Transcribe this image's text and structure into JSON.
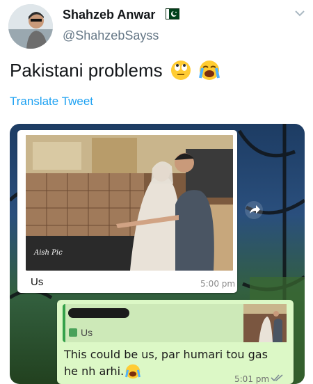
{
  "author": {
    "name": "Shahzeb Anwar",
    "handle": "@ShahzebSayss",
    "flag_icon": "pakistan-flag-icon"
  },
  "tweet": {
    "text": "Pakistani problems",
    "emojis": [
      "face-with-rolling-eyes",
      "loudly-crying-face"
    ],
    "translate_label": "Translate Tweet"
  },
  "screenshot": {
    "first_message": {
      "caption": "Us",
      "time": "5:00 pm"
    },
    "reply": {
      "quoted_label": "Us",
      "text_line1": "This could be us, par humari tou gas",
      "text_line2": "he nh arhi.",
      "time": "5:01 pm"
    }
  },
  "colors": {
    "link": "#1da1f2",
    "bubble_green": "#dcf8c6",
    "handle_gray": "#657786"
  }
}
